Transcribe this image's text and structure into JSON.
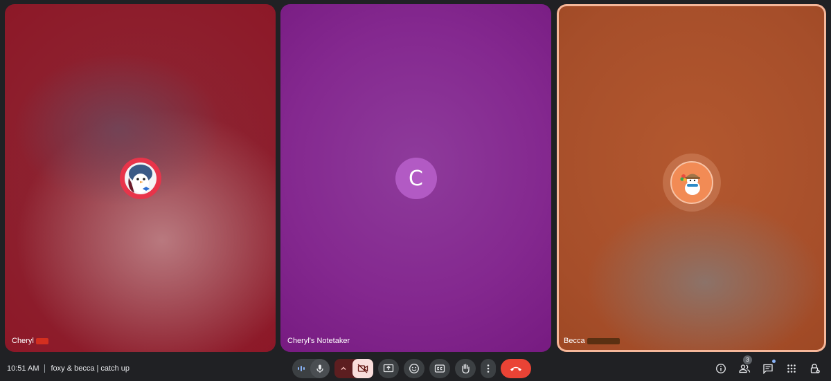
{
  "participants": [
    {
      "name": "Cheryl",
      "avatar_type": "image",
      "avatar_icon": "penguin-avatar-icon"
    },
    {
      "name": "Cheryl's Notetaker",
      "avatar_type": "letter",
      "avatar_letter": "C",
      "avatar_color": "#b25ac4"
    },
    {
      "name": "Becca",
      "avatar_type": "image",
      "avatar_icon": "snowman-avatar-icon",
      "speaking": true
    }
  ],
  "meeting": {
    "time": "10:51 AM",
    "title": "foxy & becca | catch up"
  },
  "controls": {
    "audio_level_icon": "audio-level-icon",
    "mic_icon": "microphone-icon",
    "camera_options_icon": "chevron-up-icon",
    "camera_icon": "camera-off-icon",
    "present_icon": "present-screen-icon",
    "reactions_icon": "emoji-icon",
    "captions_icon": "closed-captions-icon",
    "raise_hand_icon": "raise-hand-icon",
    "more_icon": "more-vertical-icon",
    "end_call_icon": "end-call-icon",
    "end_call_color": "#ea4335"
  },
  "right_tools": {
    "info_icon": "info-icon",
    "people_icon": "people-icon",
    "people_count": "3",
    "chat_icon": "chat-icon",
    "activities_icon": "apps-grid-icon",
    "host_controls_icon": "host-controls-lock-icon"
  }
}
